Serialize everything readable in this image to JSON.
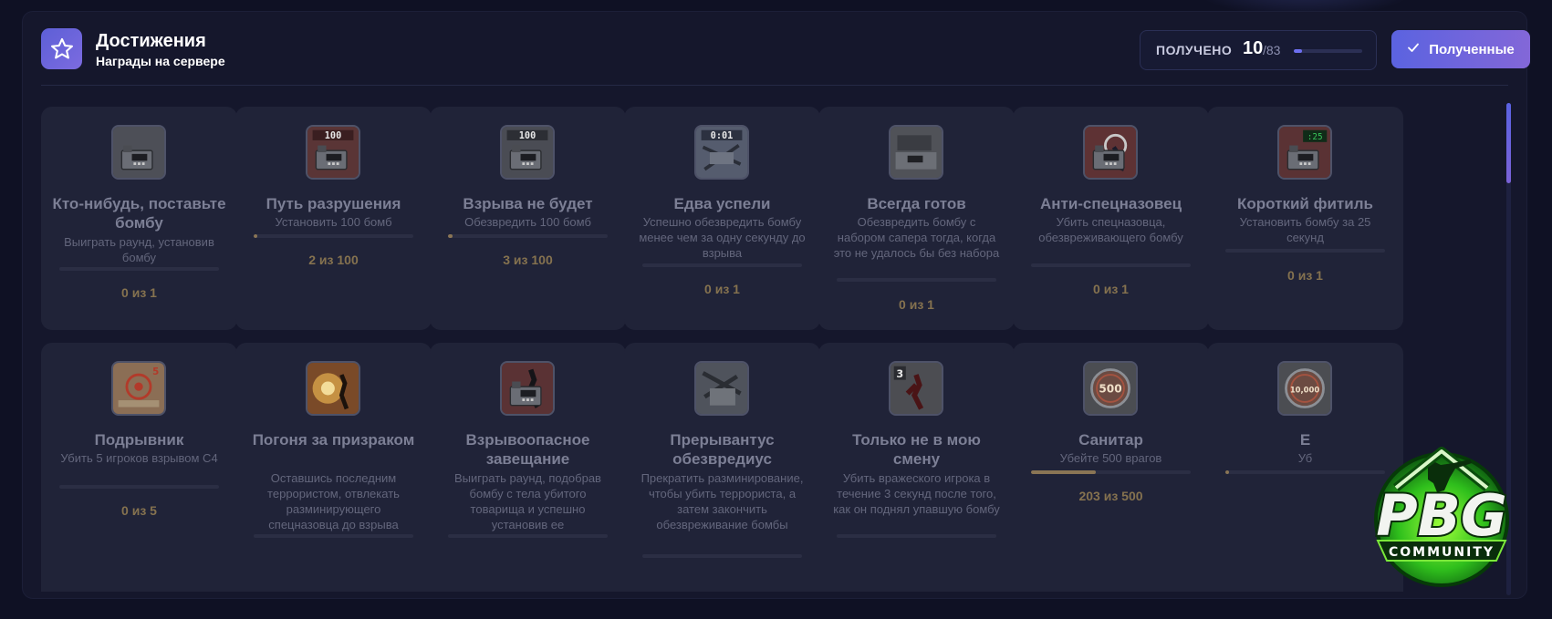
{
  "header": {
    "title": "Достижения",
    "subtitle": "Награды на сервере",
    "icon": "star-icon"
  },
  "progress": {
    "label": "ПОЛУЧЕНО",
    "value": "10",
    "total": "/83",
    "fraction": 0.12
  },
  "filter_button": {
    "label": "Полученные",
    "icon": "check-icon"
  },
  "logo": {
    "text": "PBG",
    "caption": "COMMUNITY"
  },
  "achievements": [
    {
      "title": "Кто-нибудь, поставьте бомбу",
      "desc": "Выиграть раунд, установив бомбу",
      "count": "0 из 1",
      "progress": 0,
      "icon": "bomb-icon",
      "art": "bomb"
    },
    {
      "title": "Путь разрушения",
      "desc": "Установить 100 бомб",
      "count": "2 из 100",
      "progress": 0.02,
      "icon": "bomb-100-icon",
      "art": "bomb100red",
      "badge": "100"
    },
    {
      "title": "Взрыва не будет",
      "desc": "Обезвредить 100 бомб",
      "count": "3 из 100",
      "progress": 0.03,
      "icon": "defuse-100-icon",
      "art": "bomb100grey",
      "badge": "100"
    },
    {
      "title": "Едва успели",
      "desc": "Успешно обезвредить бомбу менее чем за одну секунду до взрыва",
      "count": "0 из 1",
      "progress": 0,
      "icon": "timer-bomb-icon",
      "art": "timer",
      "badge": "0:01"
    },
    {
      "title": "Всегда готов",
      "desc": "Обезвредить бомбу с набором сапера тогда, когда это не удалось бы без набора",
      "count": "0 из 1",
      "progress": 0,
      "icon": "defuse-kit-icon",
      "art": "kit"
    },
    {
      "title": "Анти-спецназовец",
      "desc": "Убить спецназовца, обезвреживающего бомбу",
      "count": "0 из 1",
      "progress": 0,
      "icon": "anti-ct-icon",
      "art": "antict"
    },
    {
      "title": "Короткий фитиль",
      "desc": "Установить бомбу за 25 секунд",
      "count": "0 из 1",
      "progress": 0,
      "icon": "short-fuse-icon",
      "art": "fuse",
      "badge": ":25"
    },
    {
      "title": "Подрывник",
      "desc": "Убить 5 игроков взрывом C4",
      "count": "0 из 5",
      "progress": 0,
      "icon": "target-icon",
      "art": "target",
      "badge": "5"
    },
    {
      "title": "Погоня за призраком",
      "desc": "Оставшись последним террористом, отвлекать разминирующего спецназовца до взрыва",
      "count": "",
      "progress": 0,
      "icon": "explosion-icon",
      "art": "explosion"
    },
    {
      "title": "Взрывоопасное завещание",
      "desc": "Выиграть раунд, подобрав бомбу с тела убитого товарища и успешно установив ее",
      "count": "",
      "progress": 0,
      "icon": "bomb-pickup-icon",
      "art": "pickup"
    },
    {
      "title": "Прерывантус обезвредиус",
      "desc": "Прекратить разминирование, чтобы убить террориста, а затем закончить обезвреживание бомбы",
      "count": "",
      "progress": 0,
      "icon": "interrupt-defuse-icon",
      "art": "interrupt"
    },
    {
      "title": "Только не в мою смену",
      "desc": "Убить вражеского игрока в течение 3 секунд после того, как он поднял упавшую бомбу",
      "count": "",
      "progress": 0,
      "icon": "not-on-my-watch-icon",
      "art": "watch",
      "badge": "3"
    },
    {
      "title": "Санитар",
      "desc": "Убейте 500 врагов",
      "count": "203 из 500",
      "progress": 0.406,
      "icon": "medal-500-icon",
      "art": "medal",
      "badge": "500"
    },
    {
      "title": "Е",
      "desc": "Уб",
      "count": "",
      "progress": 0.02,
      "icon": "medal-10000-icon",
      "art": "medal",
      "badge": "10,000"
    }
  ]
}
